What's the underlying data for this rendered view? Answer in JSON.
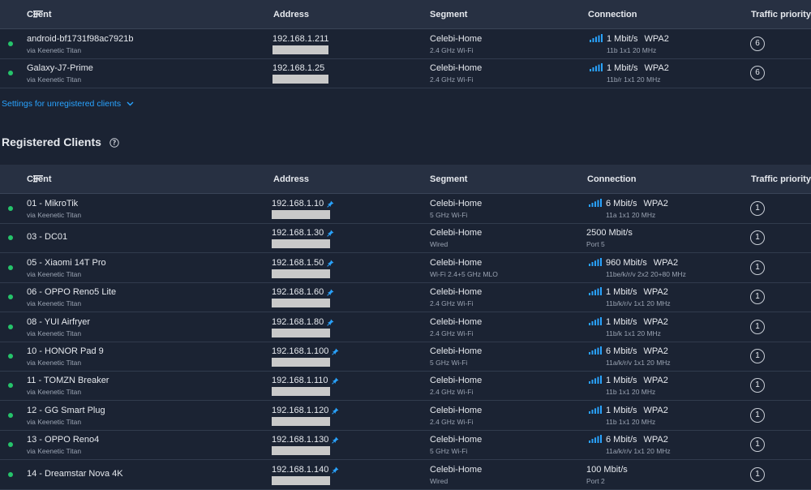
{
  "headers": {
    "client": "Client",
    "address": "Address",
    "segment": "Segment",
    "connection": "Connection",
    "priority": "Traffic priority"
  },
  "unregistered": [
    {
      "name": "android-bf1731f98ac7921b",
      "via": "via Keenetic Titan",
      "ip": "192.168.1.211",
      "segment": "Celebi-Home",
      "band": "2.4 GHz Wi-Fi",
      "speed": "1 Mbit/s",
      "security": "WPA2",
      "mode": "11b 1x1 20 MHz",
      "priority": "6",
      "wifi": true,
      "pinned": false
    },
    {
      "name": "Galaxy-J7-Prime",
      "via": "via Keenetic Titan",
      "ip": "192.168.1.25",
      "segment": "Celebi-Home",
      "band": "2.4 GHz Wi-Fi",
      "speed": "1 Mbit/s",
      "security": "WPA2",
      "mode": "11b/r 1x1 20 MHz",
      "priority": "6",
      "wifi": true,
      "pinned": false
    }
  ],
  "settings_link": "Settings for unregistered clients",
  "registered_title": "Registered Clients",
  "registered": [
    {
      "name": "01 - MikroTik",
      "via": "via Keenetic Titan",
      "ip": "192.168.1.10",
      "segment": "Celebi-Home",
      "band": "5 GHz Wi-Fi",
      "speed": "6 Mbit/s",
      "security": "WPA2",
      "mode": "11a 1x1 20 MHz",
      "priority": "1",
      "wifi": true,
      "pinned": true
    },
    {
      "name": "03 - DC01",
      "via": "",
      "ip": "192.168.1.30",
      "segment": "Celebi-Home",
      "band": "Wired",
      "speed": "2500 Mbit/s",
      "security": "",
      "mode": "Port 5",
      "priority": "1",
      "wifi": false,
      "pinned": true
    },
    {
      "name": "05 - Xiaomi 14T Pro",
      "via": "via Keenetic Titan",
      "ip": "192.168.1.50",
      "segment": "Celebi-Home",
      "band": "Wi-Fi 2.4+5 GHz MLO",
      "speed": "960 Mbit/s",
      "security": "WPA2",
      "mode": "11be/k/r/v 2x2 20+80 MHz",
      "priority": "1",
      "wifi": true,
      "pinned": true
    },
    {
      "name": "06 - OPPO Reno5 Lite",
      "via": "via Keenetic Titan",
      "ip": "192.168.1.60",
      "segment": "Celebi-Home",
      "band": "2.4 GHz Wi-Fi",
      "speed": "1 Mbit/s",
      "security": "WPA2",
      "mode": "11b/k/r/v 1x1 20 MHz",
      "priority": "1",
      "wifi": true,
      "pinned": true
    },
    {
      "name": "08 - YUI Airfryer",
      "via": "via Keenetic Titan",
      "ip": "192.168.1.80",
      "segment": "Celebi-Home",
      "band": "2.4 GHz Wi-Fi",
      "speed": "1 Mbit/s",
      "security": "WPA2",
      "mode": "11b/k 1x1 20 MHz",
      "priority": "1",
      "wifi": true,
      "pinned": true
    },
    {
      "name": "10 - HONOR Pad 9",
      "via": "via Keenetic Titan",
      "ip": "192.168.1.100",
      "segment": "Celebi-Home",
      "band": "5 GHz Wi-Fi",
      "speed": "6 Mbit/s",
      "security": "WPA2",
      "mode": "11a/k/r/v 1x1 20 MHz",
      "priority": "1",
      "wifi": true,
      "pinned": true
    },
    {
      "name": "11 - TOMZN Breaker",
      "via": "via Keenetic Titan",
      "ip": "192.168.1.110",
      "segment": "Celebi-Home",
      "band": "2.4 GHz Wi-Fi",
      "speed": "1 Mbit/s",
      "security": "WPA2",
      "mode": "11b 1x1 20 MHz",
      "priority": "1",
      "wifi": true,
      "pinned": true
    },
    {
      "name": "12 - GG Smart Plug",
      "via": "via Keenetic Titan",
      "ip": "192.168.1.120",
      "segment": "Celebi-Home",
      "band": "2.4 GHz Wi-Fi",
      "speed": "1 Mbit/s",
      "security": "WPA2",
      "mode": "11b 1x1 20 MHz",
      "priority": "1",
      "wifi": true,
      "pinned": true
    },
    {
      "name": "13 - OPPO Reno4",
      "via": "via Keenetic Titan",
      "ip": "192.168.1.130",
      "segment": "Celebi-Home",
      "band": "5 GHz Wi-Fi",
      "speed": "6 Mbit/s",
      "security": "WPA2",
      "mode": "11a/k/r/v 1x1 20 MHz",
      "priority": "1",
      "wifi": true,
      "pinned": true
    },
    {
      "name": "14 - Dreamstar Nova 4K",
      "via": "",
      "ip": "192.168.1.140",
      "segment": "Celebi-Home",
      "band": "Wired",
      "speed": "100 Mbit/s",
      "security": "",
      "mode": "Port 2",
      "priority": "1",
      "wifi": false,
      "pinned": true
    }
  ],
  "colors": {
    "online": "#25c46b",
    "accent": "#29a3ff",
    "background": "#1b2333",
    "header": "#273042"
  },
  "icons": {
    "online_status": "status-dot-icon",
    "sort": "sort-icon",
    "pin": "pin-icon",
    "signal": "wifi-signal-icon",
    "help": "help-circle-icon",
    "chevron": "chevron-down-icon"
  }
}
